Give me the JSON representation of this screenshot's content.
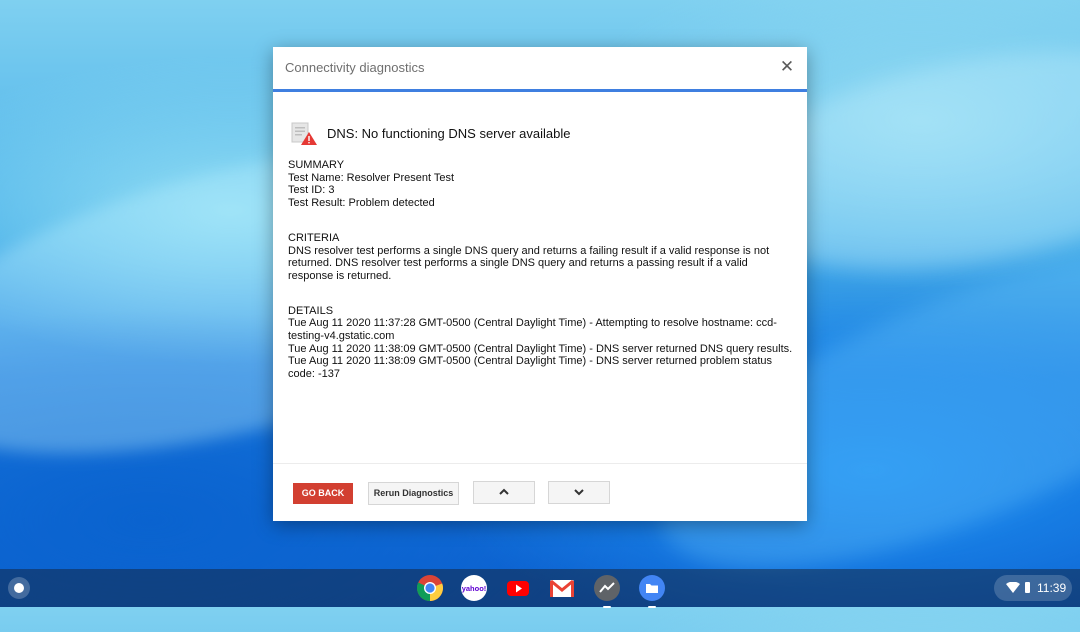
{
  "dialog": {
    "title": "Connectivity diagnostics",
    "close_icon": "close-icon"
  },
  "result": {
    "icon": "document-warning-icon",
    "heading": "DNS: No functioning DNS server available"
  },
  "summary": {
    "header": "SUMMARY",
    "test_name": "Test Name: Resolver Present Test",
    "test_id": "Test ID: 3",
    "test_result": "Test Result: Problem detected"
  },
  "criteria": {
    "header": "CRITERIA",
    "text": "DNS resolver test performs a single DNS query and returns a failing result if a valid response is not returned. DNS resolver test performs a single DNS query and returns a passing result if a valid response is returned."
  },
  "details": {
    "header": "DETAILS",
    "lines": [
      "Tue Aug 11 2020 11:37:28 GMT-0500 (Central Daylight Time) - Attempting to resolve hostname: ccd-testing-v4.gstatic.com",
      "Tue Aug 11 2020 11:38:09 GMT-0500 (Central Daylight Time) - DNS server returned DNS query results.",
      "Tue Aug 11 2020 11:38:09 GMT-0500 (Central Daylight Time) - DNS server returned problem status code: -137"
    ]
  },
  "footer": {
    "go_back": "GO BACK",
    "rerun": "Rerun Diagnostics",
    "up_icon": "chevron-up-icon",
    "down_icon": "chevron-down-icon"
  },
  "shelf": {
    "apps": [
      "chrome-icon",
      "yahoo-icon",
      "youtube-icon",
      "gmail-icon",
      "diagnostics-icon",
      "files-icon"
    ],
    "yahoo_label": "yahoo!",
    "time": "11:39"
  },
  "colors": {
    "accent": "#3f7fe0",
    "go_back_bg": "#d23f31",
    "warning": "#e53935"
  }
}
